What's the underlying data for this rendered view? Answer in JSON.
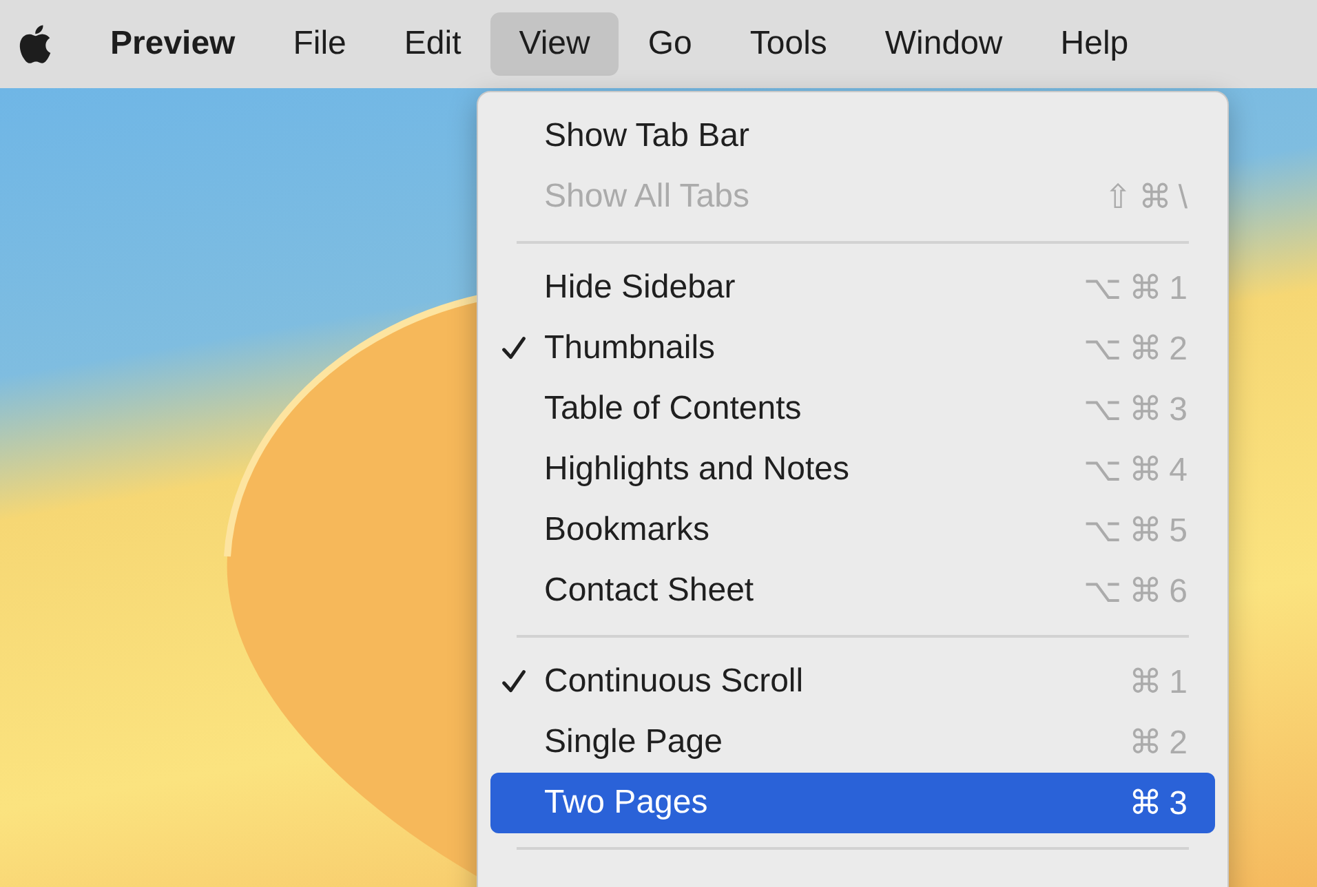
{
  "menu_bar": {
    "items": [
      {
        "label": "Preview",
        "kind": "app",
        "selected": false
      },
      {
        "label": "File",
        "kind": "menu",
        "selected": false
      },
      {
        "label": "Edit",
        "kind": "menu",
        "selected": false
      },
      {
        "label": "View",
        "kind": "menu",
        "selected": true
      },
      {
        "label": "Go",
        "kind": "menu",
        "selected": false
      },
      {
        "label": "Tools",
        "kind": "menu",
        "selected": false
      },
      {
        "label": "Window",
        "kind": "menu",
        "selected": false
      },
      {
        "label": "Help",
        "kind": "menu",
        "selected": false
      }
    ]
  },
  "view_menu": {
    "items": [
      {
        "kind": "item",
        "label": "Show Tab Bar",
        "checked": false,
        "disabled": false,
        "selected": false
      },
      {
        "kind": "item",
        "label": "Show All Tabs",
        "shortcut": "⇧⌘\\",
        "checked": false,
        "disabled": true,
        "selected": false
      },
      {
        "kind": "separator"
      },
      {
        "kind": "item",
        "label": "Hide Sidebar",
        "shortcut": "⌥⌘1",
        "checked": false,
        "disabled": false,
        "selected": false
      },
      {
        "kind": "item",
        "label": "Thumbnails",
        "shortcut": "⌥⌘2",
        "checked": true,
        "disabled": false,
        "selected": false
      },
      {
        "kind": "item",
        "label": "Table of Contents",
        "shortcut": "⌥⌘3",
        "checked": false,
        "disabled": false,
        "selected": false
      },
      {
        "kind": "item",
        "label": "Highlights and Notes",
        "shortcut": "⌥⌘4",
        "checked": false,
        "disabled": false,
        "selected": false
      },
      {
        "kind": "item",
        "label": "Bookmarks",
        "shortcut": "⌥⌘5",
        "checked": false,
        "disabled": false,
        "selected": false
      },
      {
        "kind": "item",
        "label": "Contact Sheet",
        "shortcut": "⌥⌘6",
        "checked": false,
        "disabled": false,
        "selected": false
      },
      {
        "kind": "separator"
      },
      {
        "kind": "item",
        "label": "Continuous Scroll",
        "shortcut": "⌘1",
        "checked": true,
        "disabled": false,
        "selected": false
      },
      {
        "kind": "item",
        "label": "Single Page",
        "shortcut": "⌘2",
        "checked": false,
        "disabled": false,
        "selected": false
      },
      {
        "kind": "item",
        "label": "Two Pages",
        "shortcut": "⌘3",
        "checked": false,
        "disabled": false,
        "selected": true
      },
      {
        "kind": "separator"
      }
    ]
  }
}
